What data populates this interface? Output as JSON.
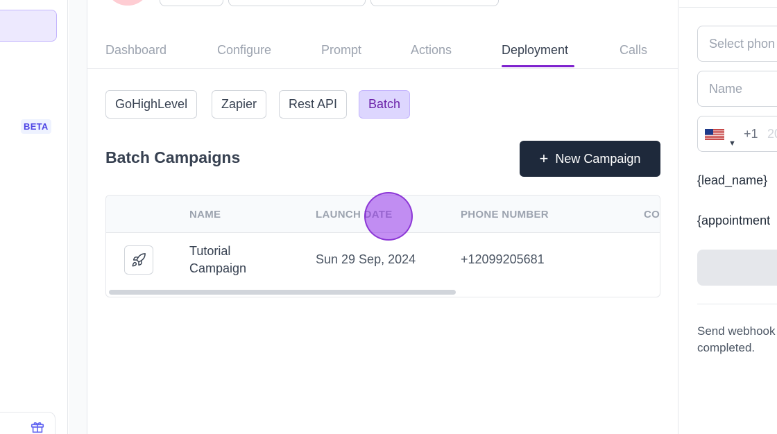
{
  "sidebar": {
    "beta_label": "BETA"
  },
  "tabs": [
    {
      "label": "Dashboard"
    },
    {
      "label": "Configure"
    },
    {
      "label": "Prompt"
    },
    {
      "label": "Actions"
    },
    {
      "label": "Deployment"
    },
    {
      "label": "Calls"
    }
  ],
  "active_tab": "Deployment",
  "subtabs": [
    {
      "label": "GoHighLevel"
    },
    {
      "label": "Zapier"
    },
    {
      "label": "Rest API"
    },
    {
      "label": "Batch"
    }
  ],
  "active_subtab": "Batch",
  "campaigns": {
    "title": "Batch Campaigns",
    "new_button_label": "New Campaign",
    "columns": [
      "NAME",
      "LAUNCH DATE",
      "PHONE NUMBER",
      "CO"
    ],
    "rows": [
      {
        "name_line1": "Tutorial",
        "name_line2": "Campaign",
        "launch_date": "Sun 29 Sep, 2024",
        "phone_number": "+12099205681"
      }
    ]
  },
  "right_panel": {
    "phone_select_placeholder": "Select phon",
    "name_placeholder": "Name",
    "dial_code": "+1",
    "phone_placeholder": "20",
    "var_lead_name": "{lead_name}",
    "var_appointment": "{appointment",
    "webhook_line1": "Send webhook",
    "webhook_line2": "completed."
  },
  "colors": {
    "accent": "#7e22ce",
    "primary_button": "#1e293b",
    "active_subtab_bg": "#ddd6fe"
  }
}
